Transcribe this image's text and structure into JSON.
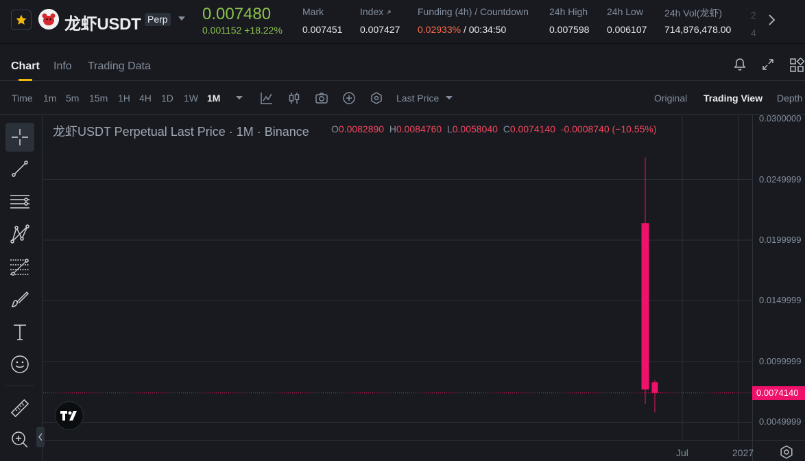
{
  "ticker": {
    "symbol": "龙虾USDT",
    "contract_type": "Perp",
    "last_price": "0.007480",
    "change": "0.001152 +18.22%",
    "stats": [
      {
        "label": "Mark",
        "value": "0.007451"
      },
      {
        "label": "Index",
        "value": "0.007427"
      },
      {
        "label": "Funding (4h) / Countdown",
        "rate": "0.02933%",
        "countdown": "/ 00:34:50"
      },
      {
        "label": "24h High",
        "value": "0.007598"
      },
      {
        "label": "24h Low",
        "value": "0.006107"
      },
      {
        "label": "24h Vol(龙虾)",
        "value": "714,876,478.00"
      }
    ],
    "clipped_stat_hint": "2\n4",
    "colors": {
      "up": "#8cc24c",
      "funding": "#ff6b4a"
    }
  },
  "tabs": [
    {
      "label": "Chart",
      "active": true
    },
    {
      "label": "Info",
      "active": false
    },
    {
      "label": "Trading Data",
      "active": false
    }
  ],
  "tab_icons": [
    "bell-icon",
    "expand-icon",
    "grid-layout-icon"
  ],
  "toolbar": {
    "time_label": "Time",
    "timeframes": [
      {
        "label": "1m",
        "active": false
      },
      {
        "label": "5m",
        "active": false
      },
      {
        "label": "15m",
        "active": false
      },
      {
        "label": "1H",
        "active": false
      },
      {
        "label": "4H",
        "active": false
      },
      {
        "label": "1D",
        "active": false
      },
      {
        "label": "1W",
        "active": false
      },
      {
        "label": "1M",
        "active": true
      }
    ],
    "price_type": "Last Price",
    "views": [
      {
        "label": "Original",
        "active": false
      },
      {
        "label": "Trading View",
        "active": true
      },
      {
        "label": "Depth",
        "active": false
      }
    ]
  },
  "drawing_tools": [
    "crosshair-icon",
    "trend-line-icon",
    "horizontal-lines-icon",
    "pattern-icon",
    "fib-icon",
    "brush-icon",
    "text-icon",
    "emoji-icon",
    "ruler-icon",
    "zoom-in-icon"
  ],
  "chart": {
    "legend": "龙虾USDT Perpetual Last Price · 1M · Binance",
    "ohlc": {
      "o": "0.0082890",
      "h": "0.0084760",
      "l": "0.0058040",
      "c": "0.0074140",
      "change": "-0.0008740 (−10.55%)"
    },
    "last_price_tag": "0.0074140",
    "colors": {
      "down": "#f0116b",
      "grid": "#2b3139"
    }
  },
  "chart_data": {
    "type": "candlestick",
    "interval": "1M",
    "y_ticks": [
      "0.0300000",
      "0.0249999",
      "0.0199999",
      "0.0149999",
      "0.0099999",
      "0.0049999"
    ],
    "x_ticks": [
      "Jul",
      "2027"
    ],
    "ylim": [
      0.0035,
      0.0302
    ],
    "candles": [
      {
        "open": 0.0214,
        "high": 0.0268,
        "low": 0.0065,
        "close": 0.0077
      },
      {
        "open": 0.008289,
        "high": 0.008476,
        "low": 0.005804,
        "close": 0.007414
      }
    ],
    "last_price": 0.007414
  }
}
